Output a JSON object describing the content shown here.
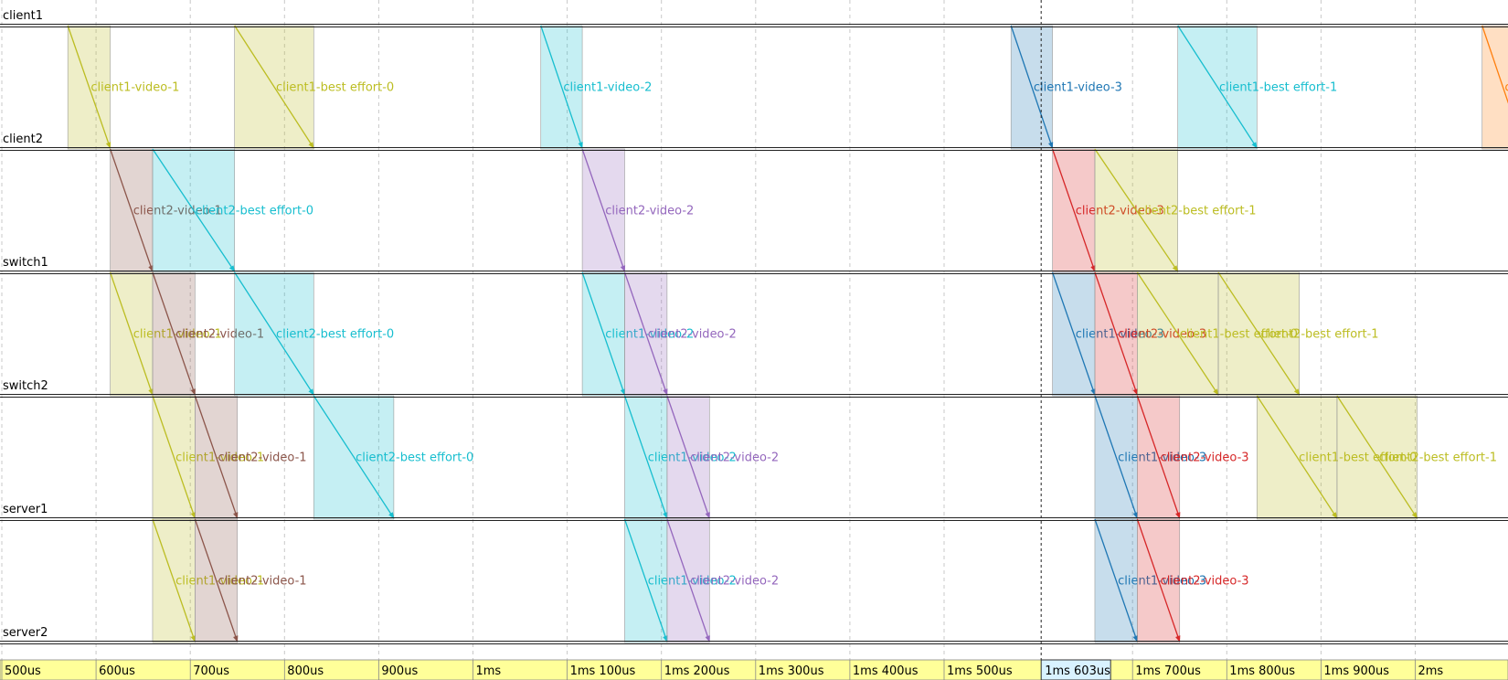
{
  "lanes": [
    "client1",
    "client2",
    "switch1",
    "switch2",
    "server1",
    "server2"
  ],
  "time_axis": {
    "ticks": [
      {
        "t": 500,
        "label": "500us"
      },
      {
        "t": 600,
        "label": "600us"
      },
      {
        "t": 700,
        "label": "700us"
      },
      {
        "t": 800,
        "label": "800us"
      },
      {
        "t": 900,
        "label": "900us"
      },
      {
        "t": 1000,
        "label": "1ms"
      },
      {
        "t": 1100,
        "label": "1ms 100us"
      },
      {
        "t": 1200,
        "label": "1ms 200us"
      },
      {
        "t": 1300,
        "label": "1ms 300us"
      },
      {
        "t": 1400,
        "label": "1ms 400us"
      },
      {
        "t": 1500,
        "label": "1ms 500us"
      },
      {
        "t": 1700,
        "label": "1ms 700us"
      },
      {
        "t": 1800,
        "label": "1ms 800us"
      },
      {
        "t": 1900,
        "label": "1ms 900us"
      },
      {
        "t": 2000,
        "label": "2ms"
      }
    ],
    "cursor": {
      "t": 1603,
      "label": "1ms 603us"
    },
    "t_min": 500,
    "t_max": 2100
  },
  "colors": {
    "olive": "#bcbd22",
    "brown": "#8c564b",
    "cyan": "#17becf",
    "purple": "#9467bd",
    "blue": "#1f77b4",
    "red": "#d62728",
    "orange": "#ff7f0e",
    "axis_bg": "#ffff99"
  },
  "transfers": [
    {
      "src": 0,
      "t0": 570,
      "t1": 615,
      "label": "client1-video-1",
      "color": "olive"
    },
    {
      "src": 0,
      "t0": 747,
      "t1": 831,
      "label": "client1-best effort-0",
      "color": "olive"
    },
    {
      "src": 0,
      "t0": 1072,
      "t1": 1116,
      "label": "client1-video-2",
      "color": "cyan"
    },
    {
      "src": 0,
      "t0": 1571,
      "t1": 1615,
      "label": "client1-video-3",
      "color": "blue"
    },
    {
      "src": 0,
      "t0": 1748,
      "t1": 1832,
      "label": "client1-best effort-1",
      "color": "cyan"
    },
    {
      "src": 0,
      "t0": 2071,
      "t1": 2115,
      "label": "c",
      "color": "orange"
    },
    {
      "src": 1,
      "t0": 615,
      "t1": 660,
      "label": "client2-video-1",
      "color": "brown"
    },
    {
      "src": 1,
      "t0": 660,
      "t1": 747,
      "label": "client2-best effort-0",
      "color": "cyan"
    },
    {
      "src": 1,
      "t0": 1116,
      "t1": 1161,
      "label": "client2-video-2",
      "color": "purple"
    },
    {
      "src": 1,
      "t0": 1615,
      "t1": 1660,
      "label": "client2-video-3",
      "color": "red"
    },
    {
      "src": 1,
      "t0": 1660,
      "t1": 1748,
      "label": "client2-best effort-1",
      "color": "olive"
    },
    {
      "src": 2,
      "t0": 615,
      "t1": 660,
      "label": "client1-video-1",
      "color": "olive"
    },
    {
      "src": 2,
      "t0": 660,
      "t1": 705,
      "label": "client2-video-1",
      "color": "brown"
    },
    {
      "src": 2,
      "t0": 747,
      "t1": 831,
      "label": "client2-best effort-0",
      "color": "cyan"
    },
    {
      "src": 2,
      "t0": 1116,
      "t1": 1161,
      "label": "client1-video-2",
      "color": "cyan"
    },
    {
      "src": 2,
      "t0": 1161,
      "t1": 1206,
      "label": "client2-video-2",
      "color": "purple"
    },
    {
      "src": 2,
      "t0": 1615,
      "t1": 1660,
      "label": "client1-video-3",
      "color": "blue"
    },
    {
      "src": 2,
      "t0": 1660,
      "t1": 1705,
      "label": "client2-video-3",
      "color": "red"
    },
    {
      "src": 2,
      "t0": 1705,
      "t1": 1791,
      "label": "client1-best effort-0",
      "color": "olive"
    },
    {
      "src": 2,
      "t0": 1791,
      "t1": 1877,
      "label": "client2-best effort-1",
      "color": "olive"
    },
    {
      "src": 3,
      "t0": 660,
      "t1": 705,
      "label": "client1-video-1",
      "color": "olive"
    },
    {
      "src": 3,
      "t0": 705,
      "t1": 750,
      "label": "client2-video-1",
      "color": "brown"
    },
    {
      "src": 3,
      "t0": 831,
      "t1": 916,
      "label": "client2-best effort-0",
      "color": "cyan"
    },
    {
      "src": 3,
      "t0": 1161,
      "t1": 1206,
      "label": "client1-video-2",
      "color": "cyan"
    },
    {
      "src": 3,
      "t0": 1206,
      "t1": 1251,
      "label": "client2-video-2",
      "color": "purple"
    },
    {
      "src": 3,
      "t0": 1660,
      "t1": 1705,
      "label": "client1-video-3",
      "color": "blue"
    },
    {
      "src": 3,
      "t0": 1705,
      "t1": 1750,
      "label": "client2-video-3",
      "color": "red"
    },
    {
      "src": 3,
      "t0": 1832,
      "t1": 1917,
      "label": "client1-best effort-0",
      "color": "olive"
    },
    {
      "src": 3,
      "t0": 1917,
      "t1": 2002,
      "label": "client2-best effort-1",
      "color": "olive"
    },
    {
      "src": 4,
      "t0": 660,
      "t1": 705,
      "label": "client1-video-1",
      "color": "olive"
    },
    {
      "src": 4,
      "t0": 705,
      "t1": 750,
      "label": "client2-video-1",
      "color": "brown"
    },
    {
      "src": 4,
      "t0": 1161,
      "t1": 1206,
      "label": "client1-video-2",
      "color": "cyan"
    },
    {
      "src": 4,
      "t0": 1206,
      "t1": 1251,
      "label": "client2-video-2",
      "color": "purple"
    },
    {
      "src": 4,
      "t0": 1660,
      "t1": 1705,
      "label": "client1-video-3",
      "color": "blue"
    },
    {
      "src": 4,
      "t0": 1705,
      "t1": 1750,
      "label": "client2-video-3",
      "color": "red"
    }
  ]
}
